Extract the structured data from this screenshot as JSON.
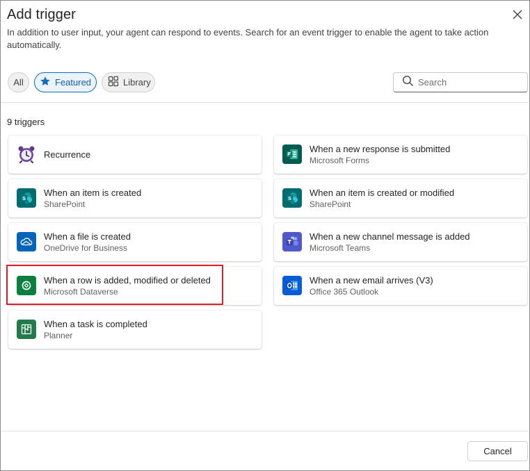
{
  "dialog": {
    "title": "Add trigger",
    "subtitle": "In addition to user input, your agent can respond to events. Search for an event trigger to enable the agent to take action automatically."
  },
  "filters": {
    "all_label": "All",
    "featured_label": "Featured",
    "library_label": "Library",
    "active": "Featured"
  },
  "search": {
    "placeholder": "Search",
    "value": ""
  },
  "count_label": "9 triggers",
  "triggers": [
    {
      "name": "Recurrence",
      "connector": "",
      "icon": "alarm-clock-icon"
    },
    {
      "name": "When a new response is submitted",
      "connector": "Microsoft Forms",
      "icon": "forms-icon"
    },
    {
      "name": "When an item is created",
      "connector": "SharePoint",
      "icon": "sharepoint-icon"
    },
    {
      "name": "When an item is created or modified",
      "connector": "SharePoint",
      "icon": "sharepoint-icon"
    },
    {
      "name": "When a file is created",
      "connector": "OneDrive for Business",
      "icon": "onedrive-icon"
    },
    {
      "name": "When a new channel message is added",
      "connector": "Microsoft Teams",
      "icon": "teams-icon"
    },
    {
      "name": "When a row is added, modified or deleted",
      "connector": "Microsoft Dataverse",
      "icon": "dataverse-icon"
    },
    {
      "name": "When a new email arrives (V3)",
      "connector": "Office 365 Outlook",
      "icon": "outlook-icon"
    },
    {
      "name": "When a task is completed",
      "connector": "Planner",
      "icon": "planner-icon"
    }
  ],
  "footer": {
    "cancel_label": "Cancel"
  },
  "colors": {
    "accent": "#0f6cbd",
    "highlight": "#e01f26",
    "sharepoint": "#036c70",
    "forms": "#035a4f",
    "onedrive": "#0364b8",
    "teams": "#5059c9",
    "dataverse": "#0b7f3f",
    "outlook": "#0a5bd6",
    "planner": "#237b4b"
  }
}
